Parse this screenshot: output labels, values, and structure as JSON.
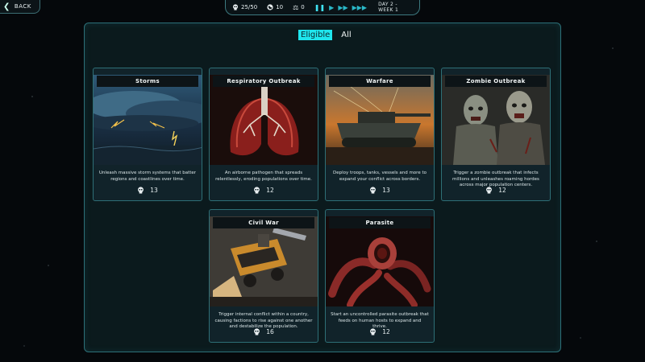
{
  "nav": {
    "back_label": "BACK"
  },
  "status": {
    "population": "25/50",
    "deaths": "10",
    "balance": "0",
    "day_label": "DAY 2 - WEEK 1"
  },
  "tabs": [
    {
      "label": "Eligible",
      "active": true
    },
    {
      "label": "All",
      "active": false
    }
  ],
  "cards": [
    {
      "title": "Storms",
      "description": "Unleash massive storm systems that batter regions and coastlines over time.",
      "cost": "13",
      "icon": "storm-art"
    },
    {
      "title": "Respiratory Outbreak",
      "description": "An airborne pathogen that spreads relentlessly, eroding populations over time.",
      "cost": "12",
      "icon": "lungs-art"
    },
    {
      "title": "Warfare",
      "description": "Deploy troops, tanks, vessels and more to expand your conflict across borders.",
      "cost": "13",
      "icon": "tank-art"
    },
    {
      "title": "Zombie Outbreak",
      "description": "Trigger a zombie outbreak that infects millions and unleashes roaming hordes across major population centers.",
      "cost": "12",
      "icon": "zombie-art"
    },
    {
      "title": "Civil War",
      "description": "Trigger internal conflict within a country, causing factions to rise against one another and destabilize the population.",
      "cost": "16",
      "icon": "civil-war-art"
    },
    {
      "title": "Parasite",
      "description": "Start an uncontrolled parasite outbreak that feeds on human hosts to expand and thrive.",
      "cost": "12",
      "icon": "parasite-art"
    }
  ],
  "colors": {
    "accent": "#1fe6ee",
    "border": "#2e6f76",
    "panel": "#0b1a1d"
  }
}
